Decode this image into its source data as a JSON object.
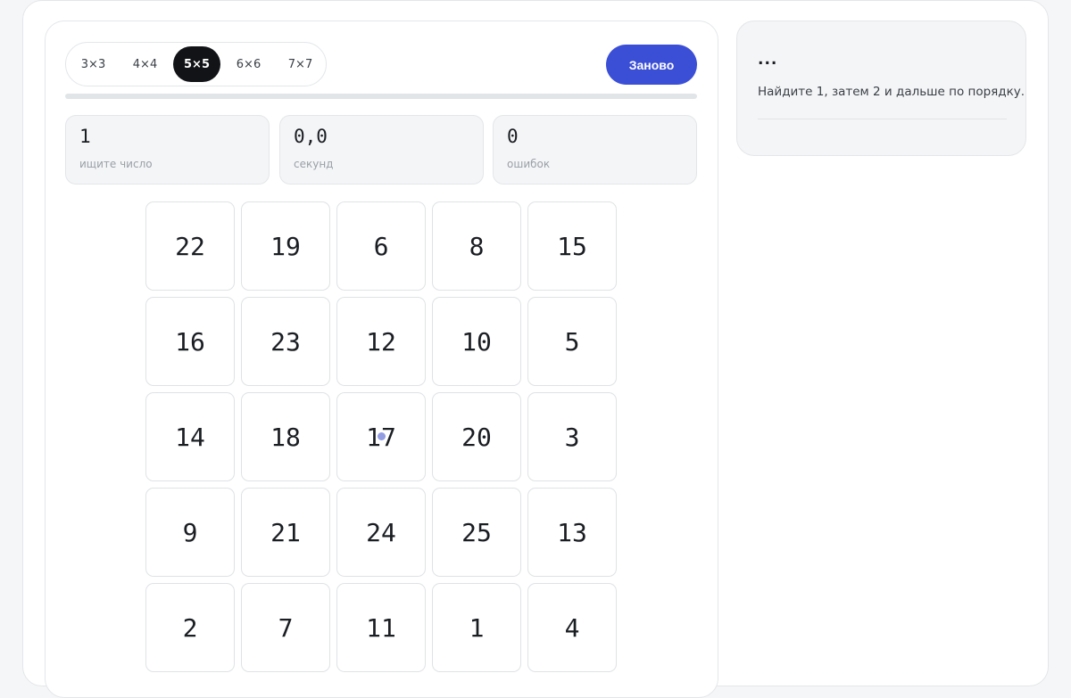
{
  "size_options": [
    {
      "label": "3×3",
      "active": false
    },
    {
      "label": "4×4",
      "active": false
    },
    {
      "label": "5×5",
      "active": true
    },
    {
      "label": "6×6",
      "active": false
    },
    {
      "label": "7×7",
      "active": false
    }
  ],
  "restart_label": "Заново",
  "progress": 0,
  "stats": [
    {
      "value": "1",
      "label": "ищите число"
    },
    {
      "value": "0,0",
      "label": "секунд"
    },
    {
      "value": "0",
      "label": "ошибок"
    }
  ],
  "grid": {
    "size": 5,
    "numbers": [
      [
        22,
        19,
        6,
        8,
        15
      ],
      [
        16,
        23,
        12,
        10,
        5
      ],
      [
        14,
        18,
        17,
        20,
        3
      ],
      [
        9,
        21,
        24,
        25,
        13
      ],
      [
        2,
        7,
        11,
        1,
        4
      ]
    ]
  },
  "info": {
    "title": "...",
    "text": "Найдите 1, затем 2 и дальше по порядку."
  },
  "colors": {
    "accent": "#3b4fd6",
    "active_option": "#111316",
    "cursor_dot": "#7f8bdc"
  }
}
